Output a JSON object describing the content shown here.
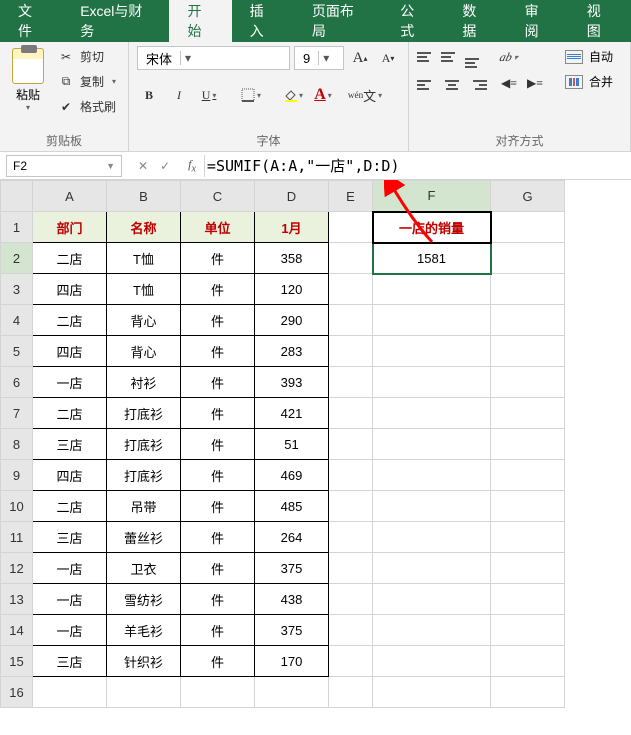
{
  "tabs": [
    "文件",
    "Excel与财务",
    "开始",
    "插入",
    "页面布局",
    "公式",
    "数据",
    "审阅",
    "视图"
  ],
  "active_tab": 2,
  "clipboard": {
    "paste": "粘贴",
    "cut": "剪切",
    "copy": "复制",
    "format_painter": "格式刷",
    "group": "剪贴板"
  },
  "font": {
    "name": "宋体",
    "size": "9",
    "group": "字体",
    "bold": "B",
    "italic": "I",
    "underline": "U"
  },
  "alignment": {
    "group": "对齐方式",
    "wrap": "自动",
    "merge": "合并"
  },
  "namebox": "F2",
  "formula": "=SUMIF(A:A,\"一店\",D:D)",
  "columns": [
    "A",
    "B",
    "C",
    "D",
    "E",
    "F",
    "G"
  ],
  "headers": {
    "A": "部门",
    "B": "名称",
    "C": "单位",
    "D": "1月"
  },
  "rows": [
    {
      "A": "二店",
      "B": "T恤",
      "C": "件",
      "D": "358"
    },
    {
      "A": "四店",
      "B": "T恤",
      "C": "件",
      "D": "120"
    },
    {
      "A": "二店",
      "B": "背心",
      "C": "件",
      "D": "290"
    },
    {
      "A": "四店",
      "B": "背心",
      "C": "件",
      "D": "283"
    },
    {
      "A": "一店",
      "B": "衬衫",
      "C": "件",
      "D": "393"
    },
    {
      "A": "二店",
      "B": "打底衫",
      "C": "件",
      "D": "421"
    },
    {
      "A": "三店",
      "B": "打底衫",
      "C": "件",
      "D": "51"
    },
    {
      "A": "四店",
      "B": "打底衫",
      "C": "件",
      "D": "469"
    },
    {
      "A": "二店",
      "B": "吊带",
      "C": "件",
      "D": "485"
    },
    {
      "A": "三店",
      "B": "蕾丝衫",
      "C": "件",
      "D": "264"
    },
    {
      "A": "一店",
      "B": "卫衣",
      "C": "件",
      "D": "375"
    },
    {
      "A": "一店",
      "B": "雪纺衫",
      "C": "件",
      "D": "438"
    },
    {
      "A": "一店",
      "B": "羊毛衫",
      "C": "件",
      "D": "375"
    },
    {
      "A": "三店",
      "B": "针织衫",
      "C": "件",
      "D": "170"
    }
  ],
  "result": {
    "label": "一店的销量",
    "value": "1581"
  }
}
